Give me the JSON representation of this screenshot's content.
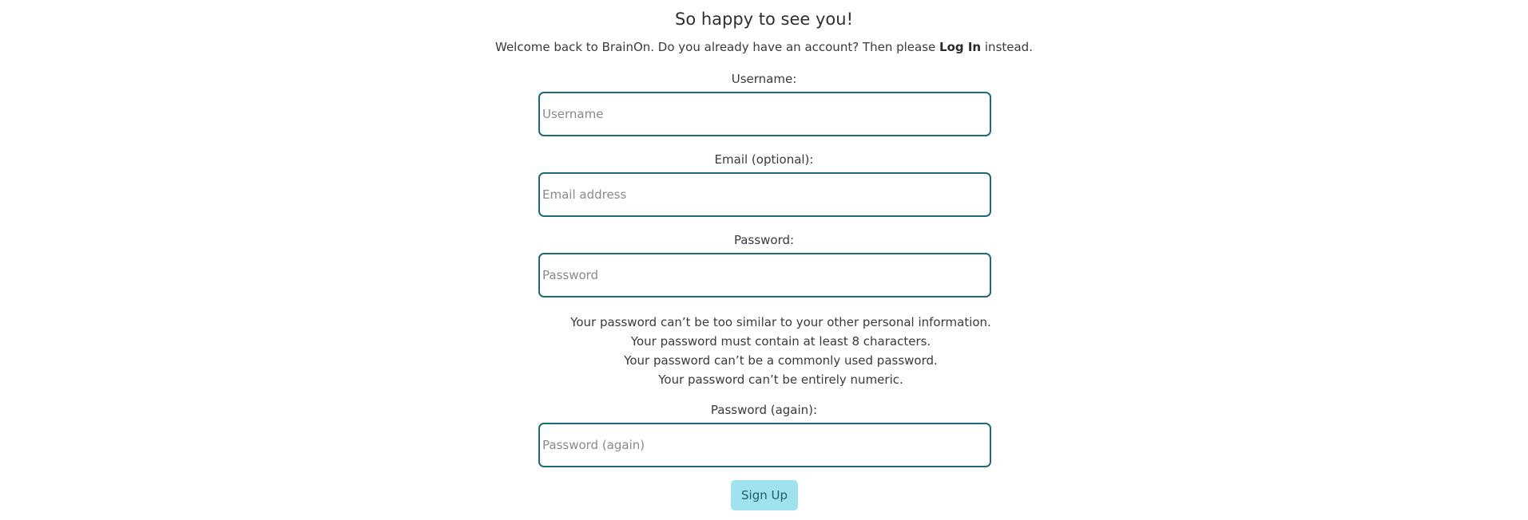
{
  "header": {
    "title": "So happy to see you!",
    "subtitle_pre": "Welcome back to BrainOn. Do you already have an account? Then please ",
    "login_link": "Log In",
    "subtitle_post": " instead."
  },
  "form": {
    "username": {
      "label": "Username:",
      "placeholder": "Username",
      "value": ""
    },
    "email": {
      "label": "Email (optional):",
      "placeholder": "Email address",
      "value": ""
    },
    "password": {
      "label": "Password:",
      "placeholder": "Password",
      "value": ""
    },
    "password_help": [
      "Your password can’t be too similar to your other personal information.",
      "Your password must contain at least 8 characters.",
      "Your password can’t be a commonly used password.",
      "Your password can’t be entirely numeric."
    ],
    "password_again": {
      "label": "Password (again):",
      "placeholder": "Password (again)",
      "value": ""
    },
    "submit_label": "Sign Up"
  },
  "colors": {
    "input_border": "#1d6a78",
    "button_bg": "#9fe3ee",
    "button_text": "#1d5f6b"
  }
}
